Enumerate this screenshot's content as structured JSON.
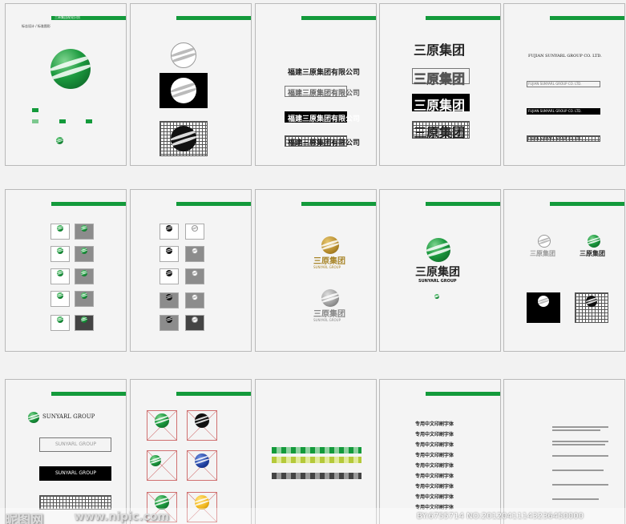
{
  "pages": {
    "p1": {
      "header": "三原集团视觉识别",
      "title": "标志设计 / 标准图形"
    },
    "p3": {
      "wordmark": "福建三原集团有限公司"
    },
    "p4": {
      "wordmark": "三原集团"
    },
    "p5": {
      "english": "FUJIAN SUNYARL GROUP CO. LTD."
    },
    "p9": {
      "cn": "三原集团",
      "en": "SUNYARL GROUP"
    },
    "p11": {
      "logo_en": "SUNYARL GROUP"
    },
    "p14": {
      "font_sample": "专用中文印刷字体"
    }
  },
  "watermark": {
    "brand": "昵图网",
    "url": "www.nipic.com",
    "id": "BY:6755714 NO:20120411143236450000"
  },
  "colors": {
    "brand_green": "#139a3b",
    "page_bg": "#f4f4f4"
  }
}
